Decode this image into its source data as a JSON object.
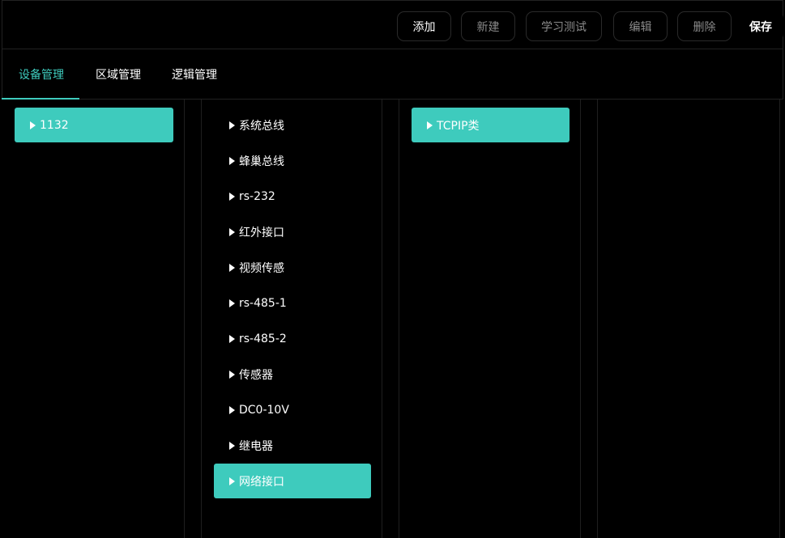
{
  "toolbar": {
    "add_label": "添加",
    "new_label": "新建",
    "learn_test_label": "学习测试",
    "edit_label": "编辑",
    "delete_label": "删除",
    "save_label": "保存"
  },
  "tabs": [
    {
      "label": "设备管理",
      "active": true
    },
    {
      "label": "区域管理",
      "active": false
    },
    {
      "label": "逻辑管理",
      "active": false
    }
  ],
  "columns": {
    "devices": [
      {
        "label": "1132",
        "selected": true
      }
    ],
    "interfaces": [
      {
        "label": "系统总线",
        "selected": false
      },
      {
        "label": "蜂巢总线",
        "selected": false
      },
      {
        "label": "rs-232",
        "selected": false
      },
      {
        "label": "红外接口",
        "selected": false
      },
      {
        "label": "视频传感",
        "selected": false
      },
      {
        "label": "rs-485-1",
        "selected": false
      },
      {
        "label": "rs-485-2",
        "selected": false
      },
      {
        "label": "传感器",
        "selected": false
      },
      {
        "label": "DC0-10V",
        "selected": false
      },
      {
        "label": "继电器",
        "selected": false
      },
      {
        "label": "网络接口",
        "selected": true
      }
    ],
    "types": [
      {
        "label": "TCPIP类",
        "selected": true
      }
    ]
  },
  "colors": {
    "accent": "#3ecbbd",
    "background": "#000000"
  },
  "icons": {
    "item_marker": "caret-right-icon"
  }
}
